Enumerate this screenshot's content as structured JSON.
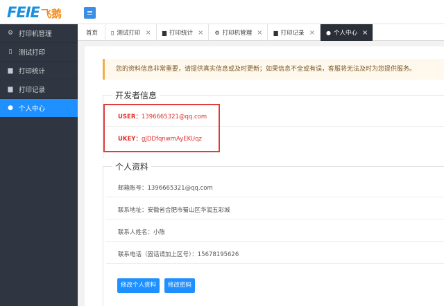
{
  "logo": {
    "latin": "FEIE",
    "chinese": "飞鹅"
  },
  "sidebar": {
    "items": [
      {
        "label": "打印机管理",
        "icon": "cogs-icon"
      },
      {
        "label": "测试打印",
        "icon": "file-icon"
      },
      {
        "label": "打印统计",
        "icon": "print-icon"
      },
      {
        "label": "打印记录",
        "icon": "print-icon"
      },
      {
        "label": "个人中心",
        "icon": "user-icon",
        "active": true
      }
    ]
  },
  "tabs": [
    {
      "label": "首页"
    },
    {
      "label": "测试打印",
      "icon": "file-icon"
    },
    {
      "label": "打印统计",
      "icon": "print-icon"
    },
    {
      "label": "打印机管理",
      "icon": "cogs-icon"
    },
    {
      "label": "打印记录",
      "icon": "print-icon"
    },
    {
      "label": "个人中心",
      "icon": "user-icon",
      "active": true
    }
  ],
  "notice": "您的资料信息非常重要，请提供真实信息或及时更新；如果信息不全或有误，客服将无法及时为您提供服务。",
  "developer": {
    "title": "开发者信息",
    "user_label": "USER：",
    "user_value": "1396665321@qq.com",
    "ukey_label": "UKEY：",
    "ukey_value": "gJDDfqnwmAyEKUqz"
  },
  "profile": {
    "title": "个人资料",
    "email_label": "邮箱账号：",
    "email_value": "1396665321@qq.com",
    "address_label": "联系地址：",
    "address_value": "安徽省合肥市蜀山区华润五彩城",
    "name_label": "联系人姓名：",
    "name_value": "小陈",
    "phone_label": "联系电话（固话请加上区号）：",
    "phone_value": "15678195626"
  },
  "buttons": {
    "edit_profile": "修改个人资料",
    "change_password": "修改密码"
  },
  "colors": {
    "accent": "#1e90ff",
    "sidebar_bg": "#303641",
    "highlight": "#e03c3c"
  }
}
